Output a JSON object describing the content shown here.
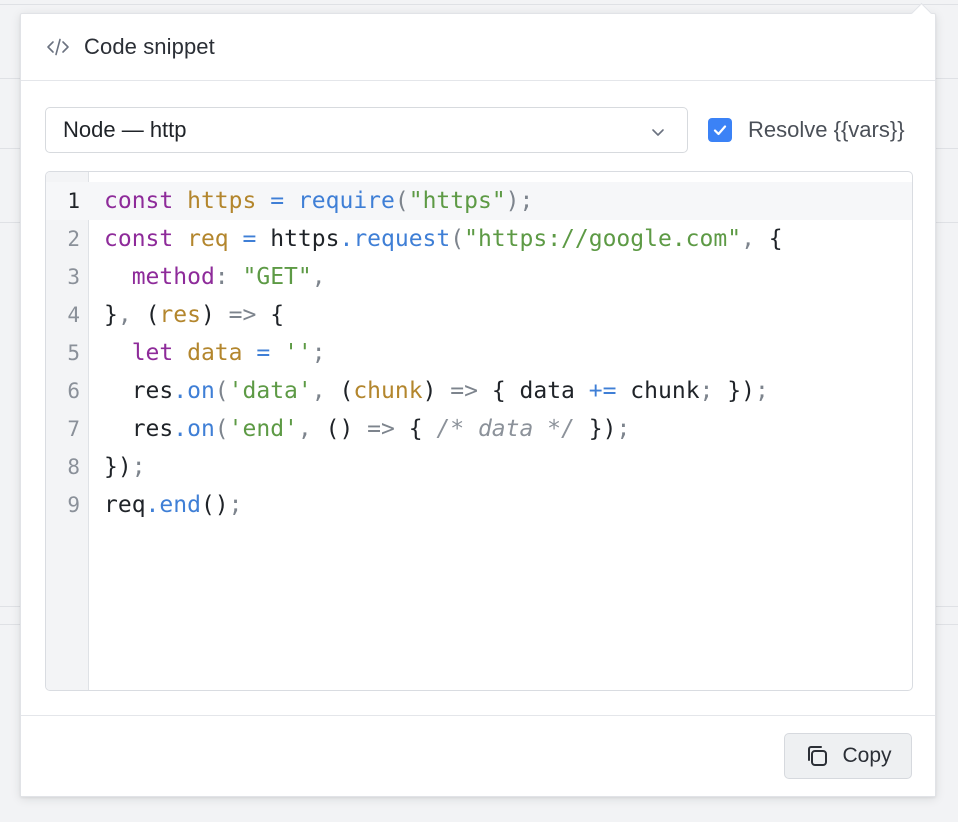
{
  "header": {
    "title": "Code snippet",
    "icon": "code-icon"
  },
  "language_select": {
    "value": "Node — http",
    "icon": "chevron-down-icon"
  },
  "resolve_vars": {
    "label": "Resolve {{vars}}",
    "checked": true,
    "color": "#3b82f6"
  },
  "editor": {
    "lines": [
      {
        "num": "1",
        "tokens": [
          [
            "kw",
            "const"
          ],
          [
            "",
            " "
          ],
          [
            "var",
            "https"
          ],
          [
            "",
            " "
          ],
          [
            "fn",
            "="
          ],
          [
            "",
            " "
          ],
          [
            "fn",
            "require"
          ],
          [
            "pun",
            "("
          ],
          [
            "str",
            "\"https\""
          ],
          [
            "pun",
            ");"
          ]
        ]
      },
      {
        "num": "2",
        "tokens": [
          [
            "kw",
            "const"
          ],
          [
            "",
            " "
          ],
          [
            "var",
            "req"
          ],
          [
            "",
            " "
          ],
          [
            "fn",
            "="
          ],
          [
            "",
            " https"
          ],
          [
            "fn",
            ".request"
          ],
          [
            "pun",
            "("
          ],
          [
            "str",
            "\"https://google.com\""
          ],
          [
            "pun",
            ","
          ],
          [
            "",
            " {"
          ]
        ]
      },
      {
        "num": "3",
        "tokens": [
          [
            "",
            "  "
          ],
          [
            "kw",
            "method"
          ],
          [
            "pun",
            ":"
          ],
          [
            "",
            " "
          ],
          [
            "str",
            "\"GET\""
          ],
          [
            "pun",
            ","
          ]
        ]
      },
      {
        "num": "4",
        "tokens": [
          [
            "",
            "}"
          ],
          [
            "pun",
            ","
          ],
          [
            "",
            " ("
          ],
          [
            "var",
            "res"
          ],
          [
            "",
            ")"
          ],
          [
            "pun",
            " =>"
          ],
          [
            "",
            " {"
          ]
        ]
      },
      {
        "num": "5",
        "tokens": [
          [
            "",
            "  "
          ],
          [
            "kw",
            "let"
          ],
          [
            "",
            " "
          ],
          [
            "var",
            "data"
          ],
          [
            "",
            " "
          ],
          [
            "fn",
            "="
          ],
          [
            "",
            " "
          ],
          [
            "str",
            "''"
          ],
          [
            "pun",
            ";"
          ]
        ]
      },
      {
        "num": "6",
        "tokens": [
          [
            "",
            "  res"
          ],
          [
            "fn",
            ".on"
          ],
          [
            "pun",
            "("
          ],
          [
            "str",
            "'data'"
          ],
          [
            "pun",
            ","
          ],
          [
            "",
            " ("
          ],
          [
            "var",
            "chunk"
          ],
          [
            "",
            ")"
          ],
          [
            "pun",
            " =>"
          ],
          [
            "",
            " { data "
          ],
          [
            "fn",
            "+="
          ],
          [
            "",
            " chunk"
          ],
          [
            "pun",
            ";"
          ],
          [
            "",
            " })"
          ],
          [
            "pun",
            ";"
          ]
        ]
      },
      {
        "num": "7",
        "tokens": [
          [
            "",
            "  res"
          ],
          [
            "fn",
            ".on"
          ],
          [
            "pun",
            "("
          ],
          [
            "str",
            "'end'"
          ],
          [
            "pun",
            ","
          ],
          [
            "",
            " ()"
          ],
          [
            "pun",
            " =>"
          ],
          [
            "",
            " { "
          ],
          [
            "cm",
            "/* data */"
          ],
          [
            "",
            " })"
          ],
          [
            "pun",
            ";"
          ]
        ]
      },
      {
        "num": "8",
        "tokens": [
          [
            "",
            "})"
          ],
          [
            "pun",
            ";"
          ]
        ]
      },
      {
        "num": "9",
        "tokens": [
          [
            "",
            "req"
          ],
          [
            "fn",
            ".end"
          ],
          [
            "",
            "()"
          ],
          [
            "pun",
            ";"
          ]
        ]
      }
    ]
  },
  "footer": {
    "copy_label": "Copy",
    "copy_icon": "copy-icon"
  }
}
